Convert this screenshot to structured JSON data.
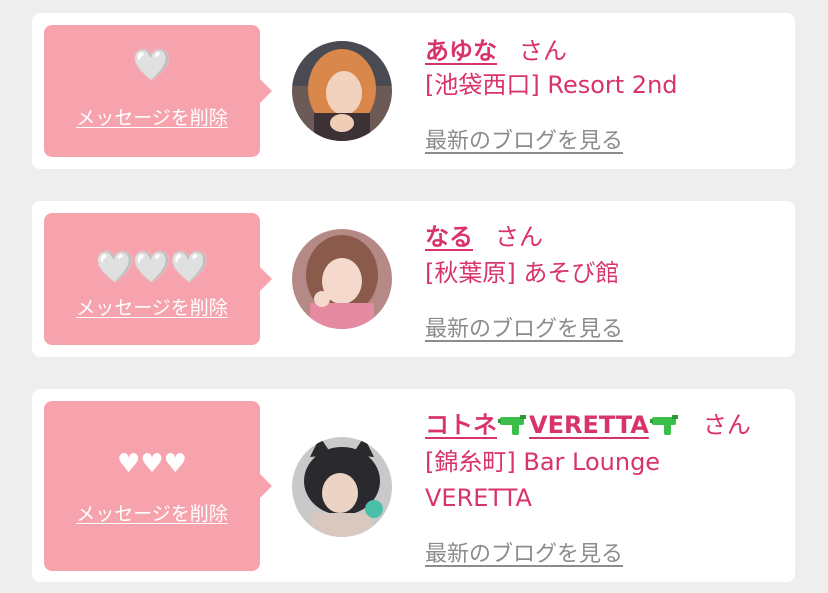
{
  "favorites": [
    {
      "name": "あゆな",
      "honorific": "さん",
      "shop": "[池袋西口] Resort 2nd",
      "blog_link": "最新のブログを見る",
      "delete_label": "メッセージを削除",
      "hearts": "🤍"
    },
    {
      "name": "なる",
      "honorific": "さん",
      "shop": "[秋葉原] あそび館",
      "blog_link": "最新のブログを見る",
      "delete_label": "メッセージを削除",
      "hearts": "🤍🤍🤍"
    },
    {
      "name_part1": "コトネ",
      "name_part2": "VERETTA",
      "honorific": "さん",
      "shop_line1": "[錦糸町] Bar Lounge",
      "shop_line2": "VERETTA",
      "blog_link": "最新のブログを見る",
      "delete_label": "メッセージを削除",
      "hearts": "♥♥♥"
    }
  ],
  "colors": {
    "accent": "#d9346a",
    "message_box": "#f7a3ae",
    "background": "#eeeeee",
    "link_gray": "#8c8c8c"
  }
}
